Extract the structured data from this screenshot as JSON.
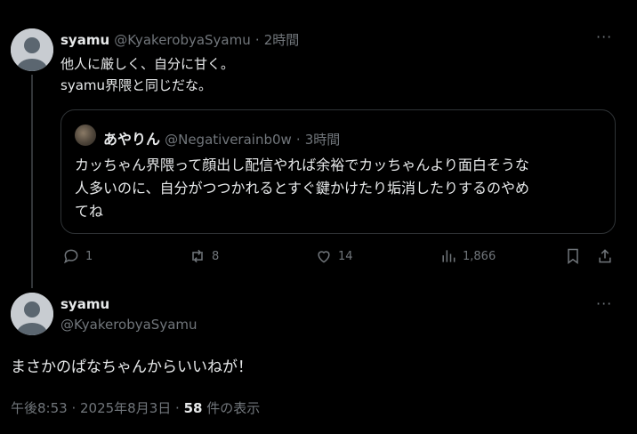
{
  "tweet1": {
    "display_name": "syamu",
    "handle": "@KyakerobyaSyamu",
    "dot": "·",
    "time": "2時間",
    "text_line1": "他人に厳しく、自分に甘く。",
    "text_line2": "syamu界隈と同じだな。",
    "more": "···",
    "quote": {
      "display_name": "あやりん",
      "handle": "@Negativerainb0w",
      "dot": "·",
      "time": "3時間",
      "line1": "カッちゃん界隈って顔出し配信やれば余裕でカッちゃんより面白そうな",
      "line2": "人多いのに、自分がつつかれるとすぐ鍵かけたり垢消したりするのやめ",
      "line3": "てね"
    },
    "actions": {
      "reply_count": "1",
      "repost_count": "8",
      "like_count": "14",
      "view_count": "1,866"
    },
    "icons": [
      "reply-icon",
      "repost-icon",
      "like-icon",
      "views-icon",
      "bookmark-icon",
      "share-icon"
    ]
  },
  "tweet2": {
    "display_name": "syamu",
    "handle": "@KyakerobyaSyamu",
    "more": "···",
    "text": "まさかのぱなちゃんからいいねが！",
    "meta_time": "午後8:53 · 2025年8月3日 · ",
    "meta_views_count": "58",
    "meta_views_label": " 件の表示"
  },
  "colors": {
    "background": "#000000",
    "text": "#e7e9ea",
    "muted": "#71767b",
    "border": "#2f3336"
  }
}
